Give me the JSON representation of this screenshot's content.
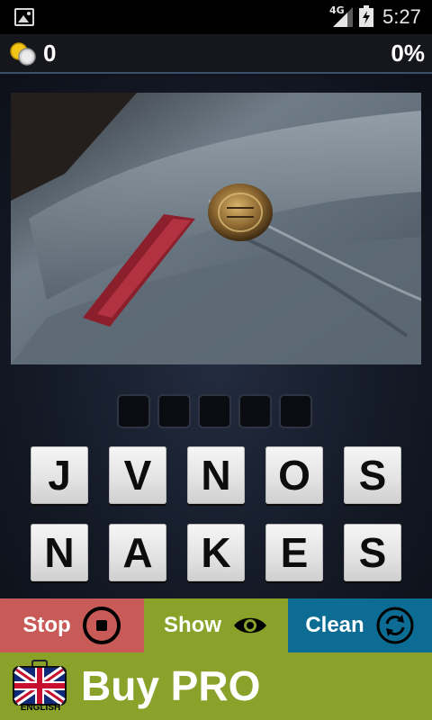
{
  "statusbar": {
    "network": "4G",
    "time": "5:27",
    "icons": [
      "image-notification-icon",
      "signal-icon",
      "battery-charging-icon"
    ]
  },
  "topbar": {
    "coins": "0",
    "progress": "0%",
    "coin_icon": "coins-icon"
  },
  "puzzle": {
    "answer_length": 5,
    "letter_rows": [
      [
        "J",
        "V",
        "N",
        "O",
        "S"
      ],
      [
        "N",
        "A",
        "K",
        "E",
        "S"
      ]
    ]
  },
  "actions": {
    "stop_label": "Stop",
    "show_label": "Show",
    "clean_label": "Clean",
    "colors": {
      "stop": "#c85b58",
      "show": "#8aa229",
      "clean": "#0d6c94"
    }
  },
  "buypro": {
    "label": "Buy PRO",
    "language": "ENGLISH",
    "flag_icon": "uk-flag-icon"
  }
}
